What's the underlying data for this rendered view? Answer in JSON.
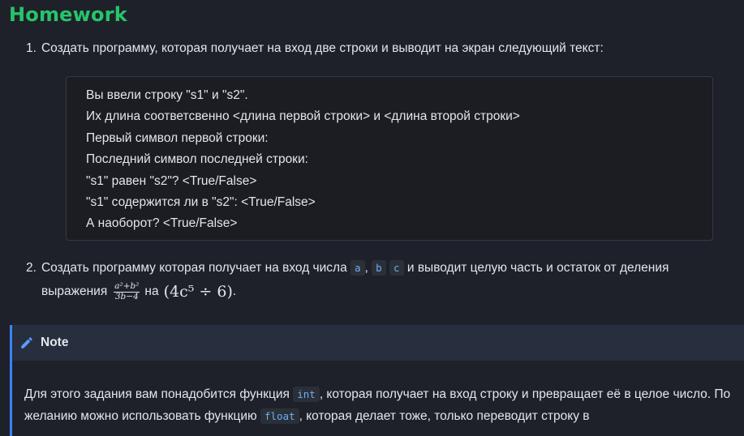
{
  "heading": "Homework",
  "task1": {
    "number": "1.",
    "text": "Создать программу, которая получает на вход две строки и выводит на экран следующий текст:",
    "code_lines": [
      "Вы ввели строку \"s1\" и \"s2\".",
      "Их длина соответсвенно <длина первой строки> и <длина второй строки>",
      "Первый символ первой строки:",
      "Последний символ последней строки:",
      "\"s1\" равен \"s2\"? <True/False>",
      "\"s1\" содержится ли в \"s2\": <True/False>",
      "А наоборот? <True/False>"
    ]
  },
  "task2": {
    "number": "2.",
    "text_before": "Создать программу которая получает на вход числа",
    "var_a": "a",
    "sep1": ",",
    "var_b": "b",
    "var_c": "c",
    "text_after": "и выводит целую часть и остаток от деления",
    "text_line2": "выражения",
    "frac_numerator": "a²+b²",
    "frac_denominator": "3b−4",
    "text_na": "на",
    "math_expr": "(4c⁵ ÷ 6)",
    "end": "."
  },
  "note": {
    "title": "Note",
    "icon": "pencil-icon",
    "accent_color": "#3b82f6",
    "body_part1": "Для этого задания вам понадобится функция",
    "code_int": "int",
    "body_part2": ", которая получает на вход строку и превращает её в целое число. По желанию можно использовать функцию",
    "code_float": "float",
    "body_part3": ", которая делает тоже, только переводит строку в"
  }
}
